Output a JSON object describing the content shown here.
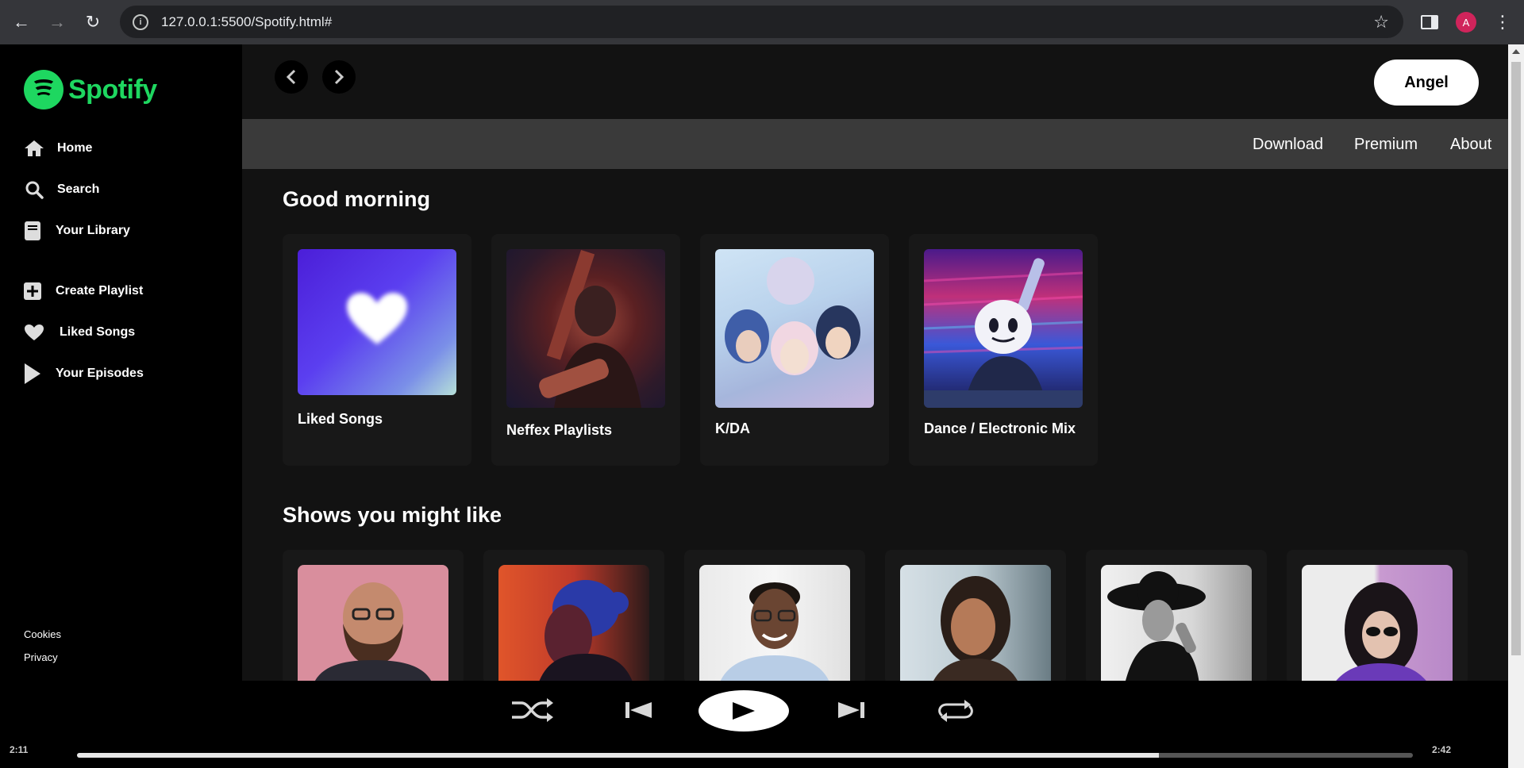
{
  "browser": {
    "url": "127.0.0.1:5500/Spotify.html#",
    "profile_initial": "A"
  },
  "sidebar": {
    "logo_text": "Spotify",
    "nav": [
      {
        "label": "Home",
        "icon": "home-icon"
      },
      {
        "label": "Search",
        "icon": "search-icon"
      },
      {
        "label": "Your Library",
        "icon": "library-icon"
      }
    ],
    "actions": [
      {
        "label": "Create Playlist",
        "icon": "plus-square-icon"
      },
      {
        "label": "Liked Songs",
        "icon": "heart-icon"
      },
      {
        "label": "Your Episodes",
        "icon": "play-triangle-icon"
      }
    ],
    "footer": [
      "Cookies",
      "Privacy"
    ]
  },
  "header": {
    "user_label": "Angel",
    "links": [
      "Download",
      "Premium",
      "About"
    ]
  },
  "greeting": "Good morning",
  "playlists": [
    {
      "title": "Liked Songs"
    },
    {
      "title": "Neffex Playlists"
    },
    {
      "title": "K/DA"
    },
    {
      "title": "Dance / Electronic Mix"
    }
  ],
  "shows_title": "Shows you might like",
  "player": {
    "elapsed": "2:11",
    "duration": "2:42",
    "progress": 0.81
  },
  "colors": {
    "brand": "#1ed760",
    "background": "#121212",
    "card": "#181818"
  }
}
